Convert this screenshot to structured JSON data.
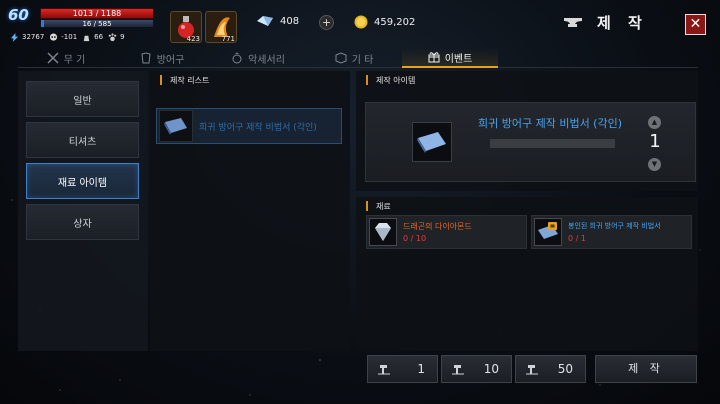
{
  "player": {
    "level": "60",
    "hp": "1013 / 1188",
    "mp": "16 / 585",
    "mp_fraction": 0.027,
    "stat_power": "32767",
    "stat_karma": "-101",
    "stat_weight": "66",
    "stat_pets": "9"
  },
  "items": {
    "hp_potion_count": "423",
    "buff_potion_count": "771"
  },
  "currency": {
    "crystal": "408",
    "gold": "459,202",
    "plus_label": "+"
  },
  "window": {
    "title": "제 작",
    "close_label": "✕"
  },
  "tabs": [
    {
      "label": "무 기"
    },
    {
      "label": "방어구"
    },
    {
      "label": "악세서리"
    },
    {
      "label": "기 타"
    },
    {
      "label": "이벤트"
    }
  ],
  "side_menu": [
    {
      "label": "일반"
    },
    {
      "label": "티셔츠"
    },
    {
      "label": "재료 아이템"
    },
    {
      "label": "상자"
    }
  ],
  "craft_list": {
    "header": "제작 리스트",
    "items": [
      {
        "label": "희귀 방어구 제작 비법서 (각인)"
      }
    ]
  },
  "craft_item": {
    "header": "제작 아이템",
    "name": "희귀 방어구 제작 비법서 (각인)",
    "quantity": "1"
  },
  "materials": {
    "header": "재료",
    "list": [
      {
        "name": "드래곤의 다이아몬드",
        "count": "0 / 10",
        "color": "#e56a2a"
      },
      {
        "name": "봉인된 희귀 방어구 제작 비법서",
        "count": "0 / 1",
        "color": "#4aa3ee"
      }
    ]
  },
  "bottom": {
    "amounts": [
      "1",
      "10",
      "50"
    ],
    "craft_label": "제 작"
  },
  "colors": {
    "accent": "#e6a11d",
    "active_blue": "#3d7fc8",
    "insufficient": "#e33b3b"
  }
}
